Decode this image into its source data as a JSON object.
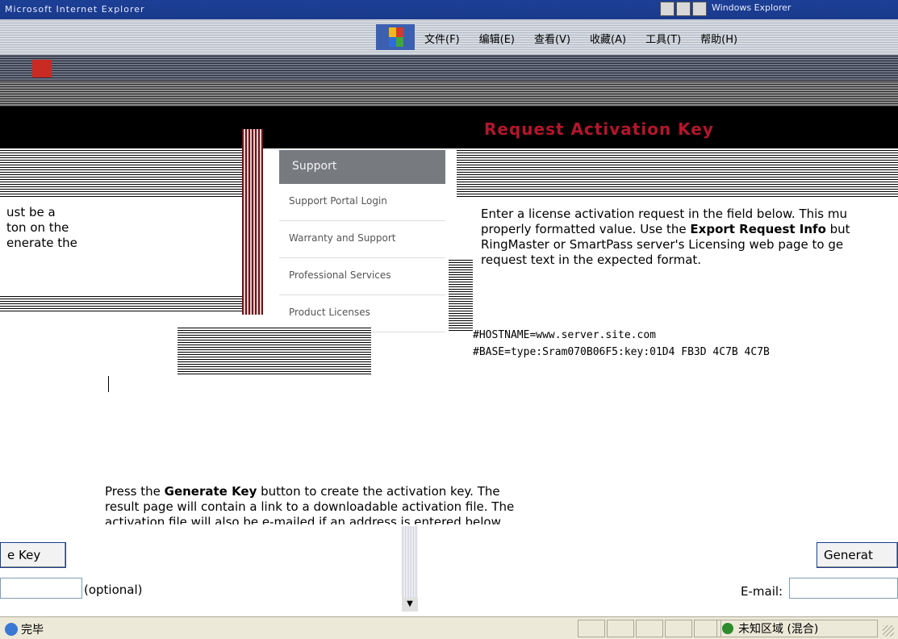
{
  "window": {
    "title": "Microsoft Internet Explorer",
    "right_tab": "Windows Explorer"
  },
  "menu": {
    "items": [
      "文件(F)",
      "编辑(E)",
      "查看(V)",
      "收藏(A)",
      "工具(T)",
      "帮助(H)"
    ]
  },
  "page": {
    "heading": "Request Activation Key"
  },
  "nav": {
    "active": "Support",
    "items": [
      "Support Portal Login",
      "Warranty and Support",
      "Professional Services",
      "Product Licenses"
    ]
  },
  "left_para": {
    "lines": [
      "ust be a",
      "ton on the",
      "enerate the"
    ]
  },
  "right_para": {
    "line1": "Enter a license activation request in the field below. This mu",
    "line2_pre": "properly formatted value. Use the ",
    "line2_bold": "Export Request Info",
    "line2_post": " but",
    "line3": "RingMaster or SmartPass server's Licensing web page to ge",
    "line4": "request text in the expected format."
  },
  "request": {
    "lines": [
      "#HOSTNAME=www.server.site.com",
      "#BASE=type:Sram070B06F5:key:01D4 FB3D 4C7B 4C7B"
    ]
  },
  "press_para": {
    "pre": "Press the ",
    "bold": "Generate Key",
    "post": " button to create the activation key. The",
    "line2": "result page will contain a link to a downloadable activation file. The",
    "line3": "activation file will also be e-mailed if an address is entered below."
  },
  "buttons": {
    "left_label": "e Key",
    "right_label": "Generat"
  },
  "email": {
    "optional_text": "(optional)",
    "label": "E-mail:"
  },
  "status": {
    "done": "完毕",
    "zone": "未知区域 (混合)"
  }
}
